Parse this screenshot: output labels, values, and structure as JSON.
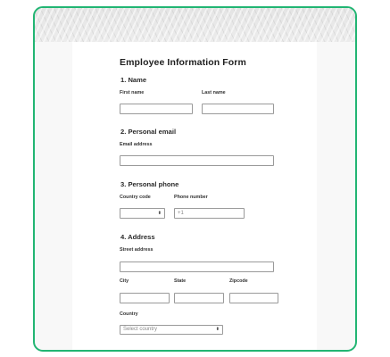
{
  "form": {
    "title": "Employee Information Form",
    "sections": {
      "name": {
        "title": "1. Name",
        "first_name_label": "First name",
        "last_name_label": "Last name"
      },
      "email": {
        "title": "2. Personal email",
        "email_label": "Email address"
      },
      "phone": {
        "title": "3. Personal phone",
        "country_code_label": "Country code",
        "phone_number_label": "Phone number",
        "phone_placeholder": "+1"
      },
      "address": {
        "title": "4. Address",
        "street_label": "Street address",
        "city_label": "City",
        "state_label": "State",
        "zipcode_label": "Zipcode",
        "country_label": "Country",
        "country_placeholder": "Select country"
      }
    },
    "arrow_glyph": "⬍"
  },
  "colors": {
    "border_accent": "#22b573"
  }
}
